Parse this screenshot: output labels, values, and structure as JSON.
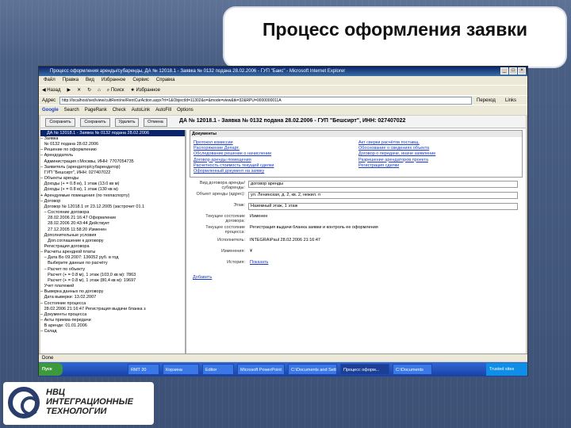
{
  "slide": {
    "title": "Процесс оформления заявки"
  },
  "window": {
    "title": "Процесс оформления аренды/субаренды, ДА № 12018.1 - Заявка № 0132 подана 28.02.2006 - ГУП \"Баис\" - Microsoft Internet Explorer",
    "menu": [
      "Файл",
      "Правка",
      "Вид",
      "Избранное",
      "Сервис",
      "Справка"
    ],
    "toolbar": [
      "Назад",
      "Поиск",
      "Избранное"
    ],
    "address_label": "Адрес",
    "address": "http://localhost/sed/view/cultRent/ne/RentCurAction.aspx?rt=1&ObjectId=11302&o=&mode=view&tk=32&RPU=0000000011A",
    "go": "Переход",
    "links": "Links",
    "gbar": [
      "Google",
      "Search",
      "PageRank",
      "Check",
      "AutoLink",
      "AutoFill",
      "Options"
    ],
    "status": "Done",
    "taskbar": {
      "start": "Пуск",
      "items": [
        "RMT 20",
        "Корзина",
        "Editor",
        "Microsoft PowerPoint",
        "C:\\Documents and Settings",
        "Процесс оформ...",
        "C:\\Documents"
      ],
      "tray": "Trusted sites"
    }
  },
  "app": {
    "buttons": [
      "Сохранить",
      "Сохранить",
      "Удалить",
      "Отмена"
    ],
    "doc_title": "ДА № 12018.1 - Заявка № 0132 подана 28.02.2006 - ГУП \"Бешсирт\", ИНН: 027407022",
    "tree_head": "ДА № 12018.1 - Заявка № 0132 подана 28.02.2006",
    "tree": [
      "– Заявка",
      "   № 0132 подана 28.02.2006",
      "– Решение по оформлению",
      "– Арендодатель",
      "   Администрация г.Москвы, ИНН: 7707054735",
      "– Заявитель (арендатор/субарендатор)",
      "   ГУП \"Бешсирт\", ИНН: 027407022",
      "– Объекты аренды",
      "   Доходы (+ = 0.8 м), 1 этаж (13.0 кв м)",
      "   Доходы (+ = 0.8 м), 1 этаж (130 кв м)",
      "+ Арендуемые помещения (по техпаспорту)",
      "– Договор",
      "   Договор № 12018.1 от 23.12.2005 (застрочит 01.1",
      "   – Состояние договора",
      "      28.02.2006 21:16:47 Оформление",
      "      28.02.2006 20:43:44 Действует",
      "      27.12.2005 11:58:20 Изменен",
      "   Дополнительные условия",
      "      Доп.соглашение к договору",
      "   Регистрация договора",
      "– Расчеты арендной платы",
      "   – Дата Во 09.2007: 136052 руб. в год",
      "      Выберите данные по расчёту",
      "   – Расчет по объекту",
      "      Расчет (+ = 0.8 м), 1 этаж (103,0 кв м): 7863",
      "      Расчет (+ = 0.8 м), 1 этаж (80,4 кв м): 19697",
      "   Учет платежей",
      "– Выверка данных по договору",
      "   Дата выверки: 13.02.2007",
      "– Состояние процесса",
      "   28.02.2006 21:16:47 Регистрация выдачи бланка з",
      "– Документы процесса",
      "– Акты приема-передачи",
      "   В аренде: 01.01.2006",
      "– Склад"
    ],
    "docs": {
      "head": "Документы",
      "col1": [
        "Протокол комиссии",
        "Распоряжение Департ.",
        "Обследование решение о начислении",
        "Договор аренды помещения",
        "Расчетность стоимость текущей сделки",
        "Оформленный документ на заявку"
      ],
      "col2": [
        "Акт сверки расчётов поставщ.",
        "Обоснование о сведениях объекта",
        "Договор о передаче, иначе заявление",
        "Разрешение арендаторов проекта",
        "Регистрация сделки"
      ]
    },
    "form": [
      {
        "label": "Вид договора аренды/субаренды:",
        "value": "договор аренды",
        "type": "select"
      },
      {
        "label": "Объект аренды (адрес):",
        "value": "ул. Ленинская, д. 2, кв. 2, нежил. п",
        "type": "select"
      },
      {
        "label": "Этаж:",
        "value": "Наземный этаж, 1 этаж",
        "type": "select"
      },
      {
        "label": "Текущее состояние договора:",
        "value": "Изменен",
        "type": "text"
      },
      {
        "label": "Текущее состояние процесса:",
        "value": "Регистрация выдачи бланка заявки и контроль ее оформления",
        "type": "text"
      },
      {
        "label": "Исполнитель:",
        "value": "INTEGRA\\Paul 28.02.2006 21:16:47",
        "type": "text"
      },
      {
        "label": "Изменения:",
        "value": "¥",
        "type": "text"
      },
      {
        "label": "История:",
        "value": "Показать",
        "type": "link"
      }
    ],
    "add_link": "Добавить"
  },
  "logo": {
    "line1": "НВЦ",
    "line2": "ИНТЕГРАЦИОННЫЕ",
    "line3": "ТЕХНОЛОГИИ"
  }
}
